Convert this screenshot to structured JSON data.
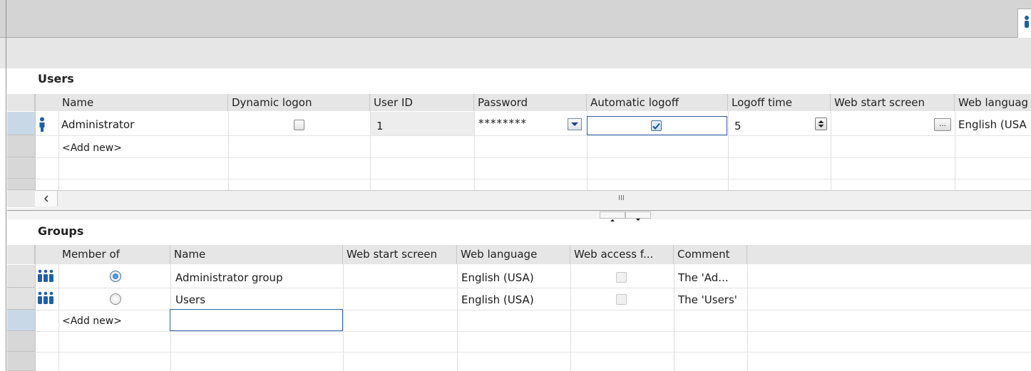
{
  "users": {
    "title": "Users",
    "columns": [
      "Name",
      "Dynamic logon",
      "User ID",
      "Password",
      "Automatic logoff",
      "Logoff time",
      "Web start screen",
      "Web languag"
    ],
    "rows": [
      {
        "name": "Administrator",
        "dynamic_logon": false,
        "user_id": "1",
        "password": "********",
        "automatic_logoff": true,
        "logoff_time": "5",
        "web_start_screen": "",
        "web_language": "English (USA"
      }
    ],
    "add_new": "<Add new>",
    "scroll_grip": "III"
  },
  "groups": {
    "title": "Groups",
    "columns": [
      "Member of",
      "Name",
      "Web start screen",
      "Web language",
      "Web access f...",
      "Comment"
    ],
    "rows": [
      {
        "member_of": true,
        "name": "Administrator group",
        "web_start_screen": "",
        "web_language": "English (USA)",
        "web_access": false,
        "comment": "The 'Ad..."
      },
      {
        "member_of": false,
        "name": "Users",
        "web_start_screen": "",
        "web_language": "English (USA)",
        "web_access": false,
        "comment": "The 'Users'"
      }
    ],
    "add_new": "<Add new>"
  },
  "icons": {
    "user_row": "user-icon",
    "group_row": "group-icon",
    "top_tab": "user-icon",
    "password_dropdown": "dropdown-arrow-icon",
    "logoff_spin": "spinner-icon",
    "browse": "ellipsis-browse-button",
    "scroll_left": "chevron-left-icon",
    "split_up": "arrow-up-icon",
    "split_down": "arrow-down-icon"
  },
  "colors": {
    "selection_border": "#2a5cad",
    "user_icon": "#1f5fa8",
    "header_bg": "#e6e6e6"
  }
}
